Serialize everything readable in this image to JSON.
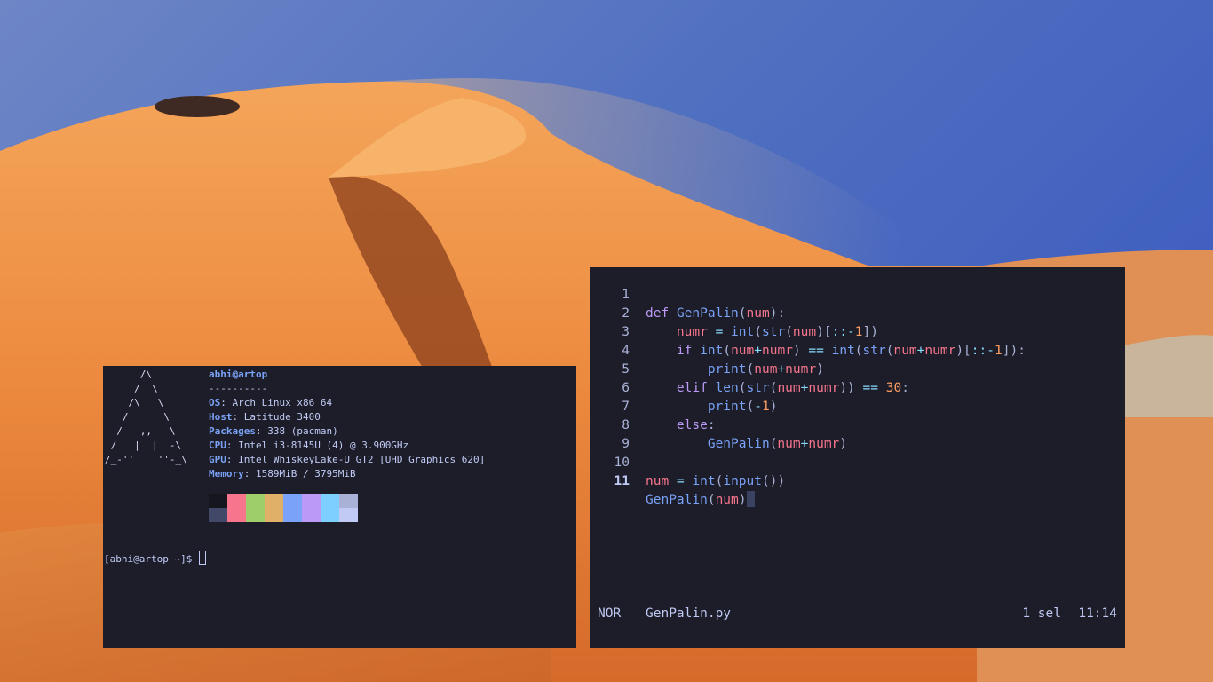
{
  "terminal": {
    "ascii_logo": "      /\\\n     /  \\\n    /\\   \\\n   /      \\\n  /   ,,   \\\n /   |  |  -\\\n/_-''    ''-_\\",
    "user_host": "abhi@artop",
    "separator": "----------",
    "info": [
      {
        "key": "OS",
        "value": "Arch Linux x86_64"
      },
      {
        "key": "Host",
        "value": "Latitude 3400"
      },
      {
        "key": "Packages",
        "value": "338 (pacman)"
      },
      {
        "key": "CPU",
        "value": "Intel i3-8145U (4) @ 3.900GHz"
      },
      {
        "key": "GPU",
        "value": "Intel WhiskeyLake-U GT2 [UHD Graphics 620]"
      },
      {
        "key": "Memory",
        "value": "1589MiB / 3795MiB"
      }
    ],
    "palette_top": [
      "#15161e",
      "#f7768e",
      "#9ece6a",
      "#e0af68",
      "#7aa2f7",
      "#bb9af7",
      "#7dcfff",
      "#a9b1d6"
    ],
    "palette_bottom": [
      "#414868",
      "#f7768e",
      "#9ece6a",
      "#e0af68",
      "#7aa2f7",
      "#bb9af7",
      "#7dcfff",
      "#c0caf5"
    ],
    "prompt": "[abhi@artop ~]$ "
  },
  "editor": {
    "line_numbers": [
      "1",
      "2",
      "3",
      "4",
      "5",
      "6",
      "7",
      "8",
      "9",
      "10",
      "11"
    ],
    "current_line": "11",
    "code": {
      "l1": {
        "kw": "def",
        "fn": "GenPalin",
        "p1": "(",
        "var": "num",
        "p2": "):"
      },
      "l2": {
        "var": "numr",
        "op": "=",
        "fn1": "int",
        "p1": "(",
        "fn2": "str",
        "p2": "(",
        "arg": "num",
        "p3": ")[",
        "op2": "::-",
        "num": "1",
        "p4": "])"
      },
      "l3": {
        "kw": "if",
        "fn1": "int",
        "p1": "(",
        "a1": "num",
        "op1": "+",
        "a2": "numr",
        "p2": ")",
        "op2": "==",
        "fn2": "int",
        "p3": "(",
        "fn3": "str",
        "p4": "(",
        "a3": "num",
        "op3": "+",
        "a4": "numr",
        "p5": ")[",
        "op4": "::-",
        "num": "1",
        "p6": "]):"
      },
      "l4": {
        "fn": "print",
        "p1": "(",
        "a1": "num",
        "op": "+",
        "a2": "numr",
        "p2": ")"
      },
      "l5": {
        "kw": "elif",
        "fn1": "len",
        "p1": "(",
        "fn2": "str",
        "p2": "(",
        "a1": "num",
        "op": "+",
        "a2": "numr",
        "p3": "))",
        "op2": "==",
        "num": "30",
        "p4": ":"
      },
      "l6": {
        "fn": "print",
        "p1": "(",
        "op": "-",
        "num": "1",
        "p2": ")"
      },
      "l7": {
        "kw": "else",
        "p": ":"
      },
      "l8": {
        "fn": "GenPalin",
        "p1": "(",
        "a1": "num",
        "op": "+",
        "a2": "numr",
        "p2": ")"
      },
      "l10": {
        "var": "num",
        "op": "=",
        "fn1": "int",
        "p1": "(",
        "fn2": "input",
        "p2": "())"
      },
      "l11": {
        "fn": "GenPalin",
        "p1": "(",
        "a1": "num",
        "p2": ")"
      }
    },
    "status": {
      "mode": "NOR",
      "filename": "GenPalin.py",
      "selection": "1 sel",
      "position": "11:14"
    }
  }
}
